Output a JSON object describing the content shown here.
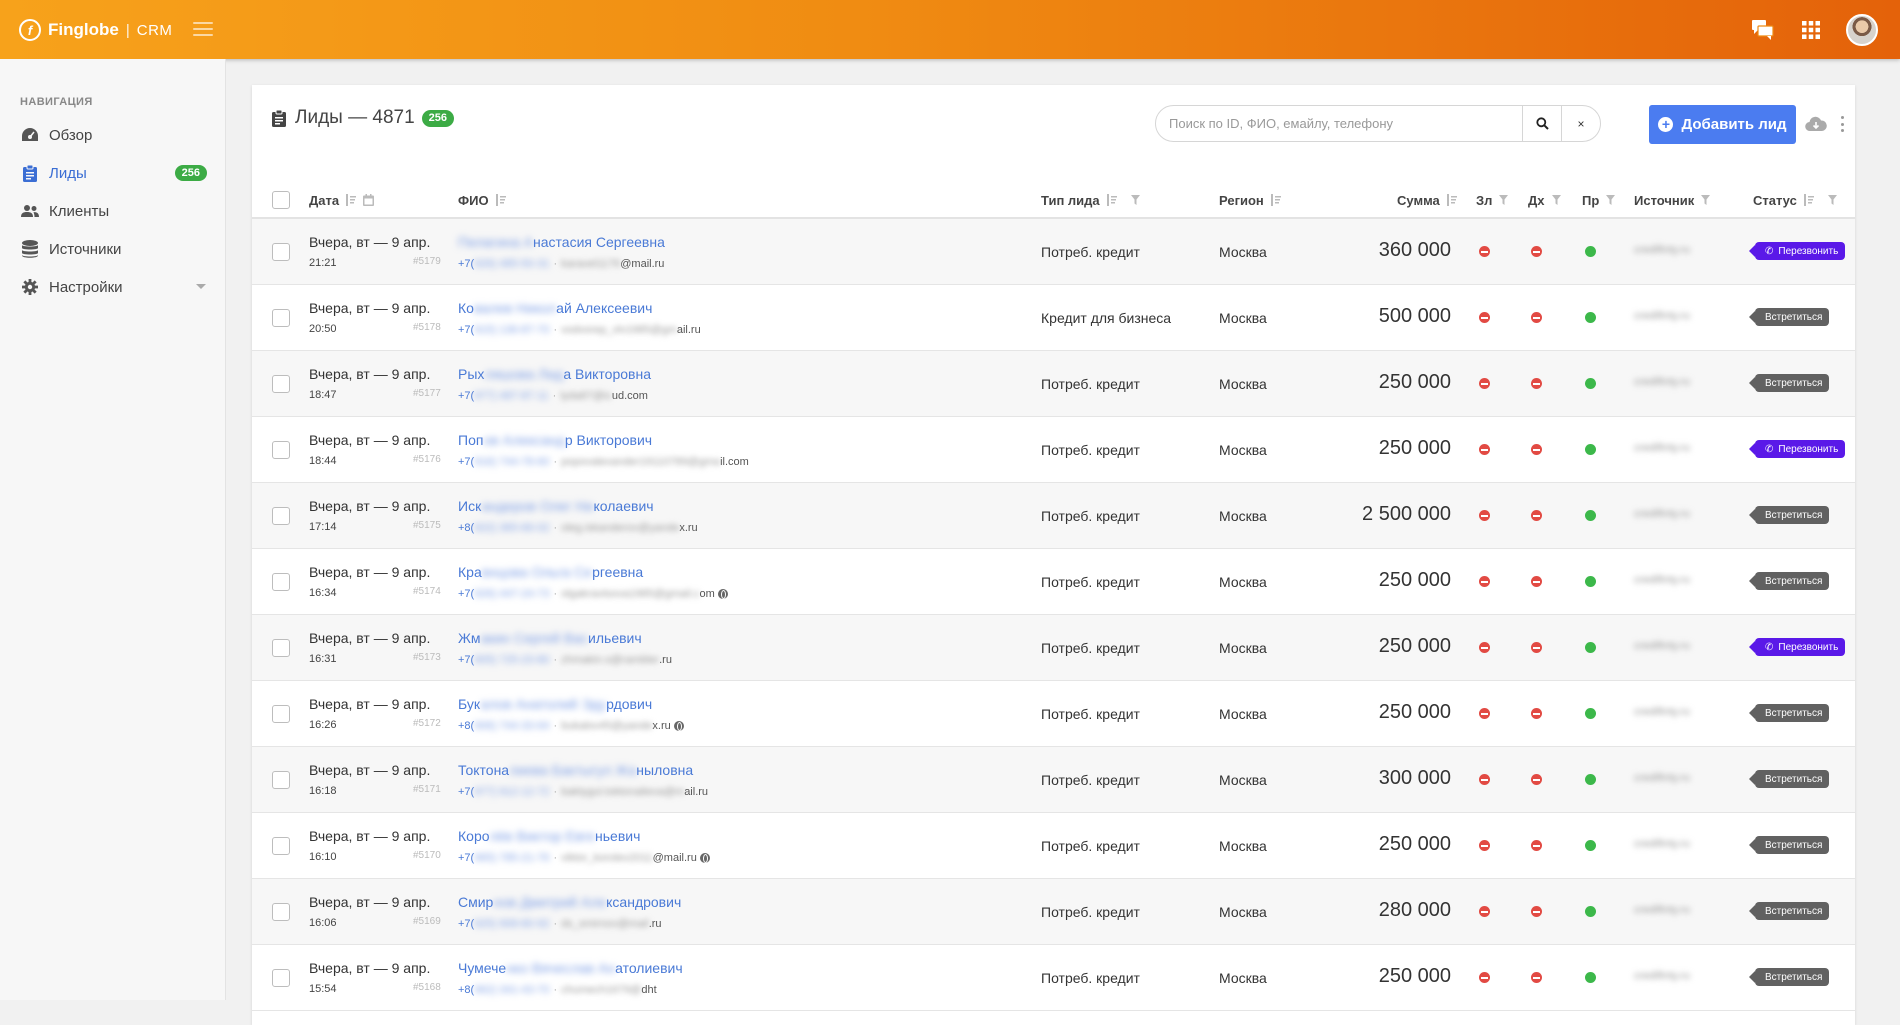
{
  "app": {
    "logo_name": "Finglobe",
    "logo_sep": "|",
    "logo_product": "CRM"
  },
  "colors": {
    "accent": "#4b7cf0",
    "topbar_start": "#f7a21b",
    "topbar_end": "#e4620a",
    "badge_green": "#3cab45",
    "status_call": "#5a19e8",
    "status_meet": "#616161"
  },
  "sidebar": {
    "title": "НАВИГАЦИЯ",
    "items": [
      {
        "label": "Обзор",
        "icon": "dashboard-icon"
      },
      {
        "label": "Лиды",
        "icon": "clipboard-icon",
        "badge": "256",
        "active": true
      },
      {
        "label": "Клиенты",
        "icon": "users-icon"
      },
      {
        "label": "Источники",
        "icon": "database-icon"
      },
      {
        "label": "Настройки",
        "icon": "gear-icon",
        "has_caret": true
      }
    ]
  },
  "main": {
    "title": "Лиды — 4871",
    "title_badge": "256",
    "search_placeholder": "Поиск по ID, ФИО, емайлу, телефону",
    "clear_label": "×",
    "add_button_label": "Добавить лид"
  },
  "table": {
    "columns": {
      "date": "Дата",
      "fio": "ФИО",
      "type": "Тип лида",
      "region": "Регион",
      "sum": "Сумма",
      "zl": "Зл",
      "dh": "Дх",
      "pr": "Пр",
      "source": "Источник",
      "status": "Статус"
    },
    "rows": [
      {
        "date": "Вчера, вт — 9 апр.",
        "time": "21:21",
        "id": "#5179",
        "fio_vis": "",
        "fio_blur": "Пелагина А",
        "fio_tail": "настасия Сергеевна",
        "phone": "+7(",
        "phone_blur": "926) 485-50-31",
        "email_blur": "karavel1176",
        "email_tail": "@mail.ru",
        "globe": false,
        "type": "Потреб. кредит",
        "region": "Москва",
        "sum": "360 000",
        "zl": "red",
        "dh": "red",
        "pr": "green",
        "source": "credifinty.ru",
        "status": "Перезвонить",
        "status_kind": "call"
      },
      {
        "date": "Вчера, вт — 9 апр.",
        "time": "20:50",
        "id": "#5178",
        "fio_vis": "Ко",
        "fio_blur": "валев Никол",
        "fio_tail": "ай Алексеевич",
        "phone": "+7(",
        "phone_blur": "915) 136-87-70",
        "email_blur": "vodvorep_vlv1985@gm",
        "email_tail": "ail.ru",
        "globe": false,
        "type": "Кредит для бизнеса",
        "region": "Москва",
        "sum": "500 000",
        "zl": "red",
        "dh": "red",
        "pr": "green",
        "source": "credifinty.ru",
        "status": "Встретиться",
        "status_kind": "meet"
      },
      {
        "date": "Вчера, вт — 9 апр.",
        "time": "18:47",
        "id": "#5177",
        "fio_vis": "Рых",
        "fio_blur": "ляшова Лид",
        "fio_tail": "а Викторовна",
        "phone": "+7(",
        "phone_blur": "977) 487-87-11",
        "email_blur": "lyda87@ic",
        "email_tail": "ud.com",
        "globe": false,
        "type": "Потреб. кредит",
        "region": "Москва",
        "sum": "250 000",
        "zl": "red",
        "dh": "red",
        "pr": "green",
        "source": "credifinty.ru",
        "status": "Встретиться",
        "status_kind": "meet"
      },
      {
        "date": "Вчера, вт — 9 апр.",
        "time": "18:44",
        "id": "#5176",
        "fio_vis": "Поп",
        "fio_blur": "ов Александ",
        "fio_tail": "р Викторович",
        "phone": "+7(",
        "phone_blur": "916) 744-78-60",
        "email_blur": "popovalexander19110789@gma",
        "email_tail": "il.com",
        "globe": false,
        "type": "Потреб. кредит",
        "region": "Москва",
        "sum": "250 000",
        "zl": "red",
        "dh": "red",
        "pr": "green",
        "source": "credifinty.ru",
        "status": "Перезвонить",
        "status_kind": "call"
      },
      {
        "date": "Вчера, вт — 9 апр.",
        "time": "17:14",
        "id": "#5175",
        "fio_vis": "Иск",
        "fio_blur": "андеров Олег Ни",
        "fio_tail": "колаевич",
        "phone": "+8(",
        "phone_blur": "922) 365-66-02",
        "email_blur": "oleg.iskanderov@yande",
        "email_tail": "x.ru",
        "globe": false,
        "type": "Потреб. кредит",
        "region": "Москва",
        "sum": "2 500 000",
        "zl": "red",
        "dh": "red",
        "pr": "green",
        "source": "credifinty.ru",
        "status": "Встретиться",
        "status_kind": "meet"
      },
      {
        "date": "Вчера, вт — 9 апр.",
        "time": "16:34",
        "id": "#5174",
        "fio_vis": "Кра",
        "fio_blur": "внцова Ольга Се",
        "fio_tail": "ргеевна",
        "phone": "+7(",
        "phone_blur": "926) 447-24-73",
        "email_blur": "olgakravtsova1985@gmail.c",
        "email_tail": "om",
        "globe": true,
        "type": "Потреб. кредит",
        "region": "Москва",
        "sum": "250 000",
        "zl": "red",
        "dh": "red",
        "pr": "green",
        "source": "credifinty.ru",
        "status": "Встретиться",
        "status_kind": "meet"
      },
      {
        "date": "Вчера, вт — 9 апр.",
        "time": "16:31",
        "id": "#5173",
        "fio_vis": "Жм",
        "fio_blur": "акин Сергей Вас",
        "fio_tail": "ильевич",
        "phone": "+7(",
        "phone_blur": "905) 725-23-80",
        "email_blur": "zhmakin.s@rambler",
        "email_tail": ".ru",
        "globe": false,
        "type": "Потреб. кредит",
        "region": "Москва",
        "sum": "250 000",
        "zl": "red",
        "dh": "red",
        "pr": "green",
        "source": "credifinty.ru",
        "status": "Перезвонить",
        "status_kind": "call"
      },
      {
        "date": "Вчера, вт — 9 апр.",
        "time": "16:26",
        "id": "#5172",
        "fio_vis": "Бук",
        "fio_blur": "алов Анатолий Эду",
        "fio_tail": "рдович",
        "phone": "+8(",
        "phone_blur": "906) 744-33-64",
        "email_blur": "bukalov45@yande",
        "email_tail": "x.ru",
        "globe": true,
        "type": "Потреб. кредит",
        "region": "Москва",
        "sum": "250 000",
        "zl": "red",
        "dh": "red",
        "pr": "green",
        "source": "credifinty.ru",
        "status": "Встретиться",
        "status_kind": "meet"
      },
      {
        "date": "Вчера, вт — 9 апр.",
        "time": "16:18",
        "id": "#5171",
        "fio_vis": "Токтона",
        "fio_blur": "лиева Бактыгул Жа",
        "fio_tail": "ныловна",
        "phone": "+7(",
        "phone_blur": "977) 912-12-72",
        "email_blur": "baktygul.toktonalieva@m",
        "email_tail": "ail.ru",
        "globe": false,
        "type": "Потреб. кредит",
        "region": "Москва",
        "sum": "300 000",
        "zl": "red",
        "dh": "red",
        "pr": "green",
        "source": "credifinty.ru",
        "status": "Встретиться",
        "status_kind": "meet"
      },
      {
        "date": "Вчера, вт — 9 апр.",
        "time": "16:10",
        "id": "#5170",
        "fio_vis": "Коро",
        "fio_blur": "лёв Виктор Евге",
        "fio_tail": "ньевич",
        "phone": "+7(",
        "phone_blur": "965) 785-21-76",
        "email_blur": "viktor_korolev2011",
        "email_tail": "@mail.ru",
        "globe": true,
        "type": "Потреб. кредит",
        "region": "Москва",
        "sum": "250 000",
        "zl": "red",
        "dh": "red",
        "pr": "green",
        "source": "credifinty.ru",
        "status": "Встретиться",
        "status_kind": "meet"
      },
      {
        "date": "Вчера, вт — 9 апр.",
        "time": "16:06",
        "id": "#5169",
        "fio_vis": "Смир",
        "fio_blur": "нов Дмитрий Але",
        "fio_tail": "ксандрович",
        "phone": "+7(",
        "phone_blur": "925) 908-80-92",
        "email_blur": "ds_smirnov@mail",
        "email_tail": ".ru",
        "globe": false,
        "type": "Потреб. кредит",
        "region": "Москва",
        "sum": "280 000",
        "zl": "red",
        "dh": "red",
        "pr": "green",
        "source": "credifinty.ru",
        "status": "Встретиться",
        "status_kind": "meet"
      },
      {
        "date": "Вчера, вт — 9 апр.",
        "time": "15:54",
        "id": "#5168",
        "fio_vis": "Чумече",
        "fio_blur": "нко Вячеслав Ан",
        "fio_tail": "атолиевич",
        "phone": "+8(",
        "phone_blur": "962) 341-43-70",
        "email_blur": "chumech1679@",
        "email_tail": "dht",
        "globe": false,
        "type": "Потреб. кредит",
        "region": "Москва",
        "sum": "250 000",
        "zl": "red",
        "dh": "red",
        "pr": "green",
        "source": "credifinty.ru",
        "status": "Встретиться",
        "status_kind": "meet"
      }
    ]
  }
}
